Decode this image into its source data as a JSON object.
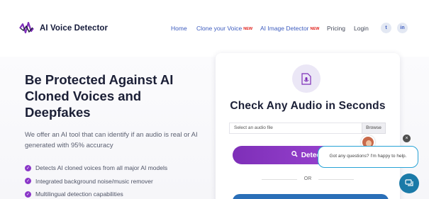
{
  "brand": {
    "name": "AI Voice Detector"
  },
  "nav": {
    "home": "Home",
    "clone": "Clone your Voice",
    "clone_badge": "NEW",
    "image": "AI Image Detector",
    "image_badge": "NEW",
    "pricing": "Pricing",
    "login": "Login"
  },
  "social": {
    "twitter": "twitter-icon",
    "linkedin": "linkedin-icon",
    "twitter_glyph": "t",
    "linkedin_glyph": "in"
  },
  "hero": {
    "title": "Be Protected Against AI Cloned Voices and Deepfakes",
    "description": "We offer an AI tool that can identify if an audio is real or AI generated with 95% accuracy",
    "features": [
      "Detects AI cloned voices from all major AI models",
      "Integrated background noise/music remover",
      "Multilingual detection capabilities"
    ]
  },
  "card": {
    "title": "Check Any Audio in Seconds",
    "file_placeholder": "Select an audio file",
    "browse": "Browse",
    "detect_button": "Detect",
    "or": "OR"
  },
  "chat": {
    "message": "Got any questions? I'm happy to help.",
    "close": "×"
  },
  "colors": {
    "accent": "#8a36c8",
    "nav_link": "#3d5cbf",
    "badge": "#e0201b",
    "chat": "#28a3d6"
  }
}
